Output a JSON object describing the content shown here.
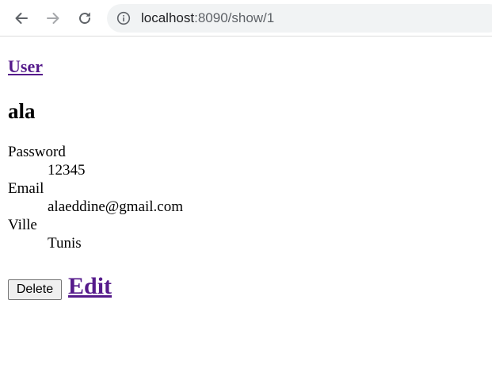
{
  "browser": {
    "url_host": "localhost",
    "url_rest": ":8090/show/1",
    "icons": {
      "back": "arrow-left-icon",
      "forward": "arrow-right-icon",
      "reload": "reload-icon",
      "site_info": "info-circle-icon"
    }
  },
  "page": {
    "back_link": "User",
    "title": "ala",
    "fields": [
      {
        "label": "Password",
        "value": "12345"
      },
      {
        "label": "Email",
        "value": "alaeddine@gmail.com"
      },
      {
        "label": "Ville",
        "value": "Tunis"
      }
    ],
    "actions": {
      "delete_label": "Delete",
      "edit_label": "Edit"
    },
    "colors": {
      "link": "#551a8b",
      "button_bg": "#efefef",
      "omnibox_bg": "#f1f3f4"
    }
  }
}
